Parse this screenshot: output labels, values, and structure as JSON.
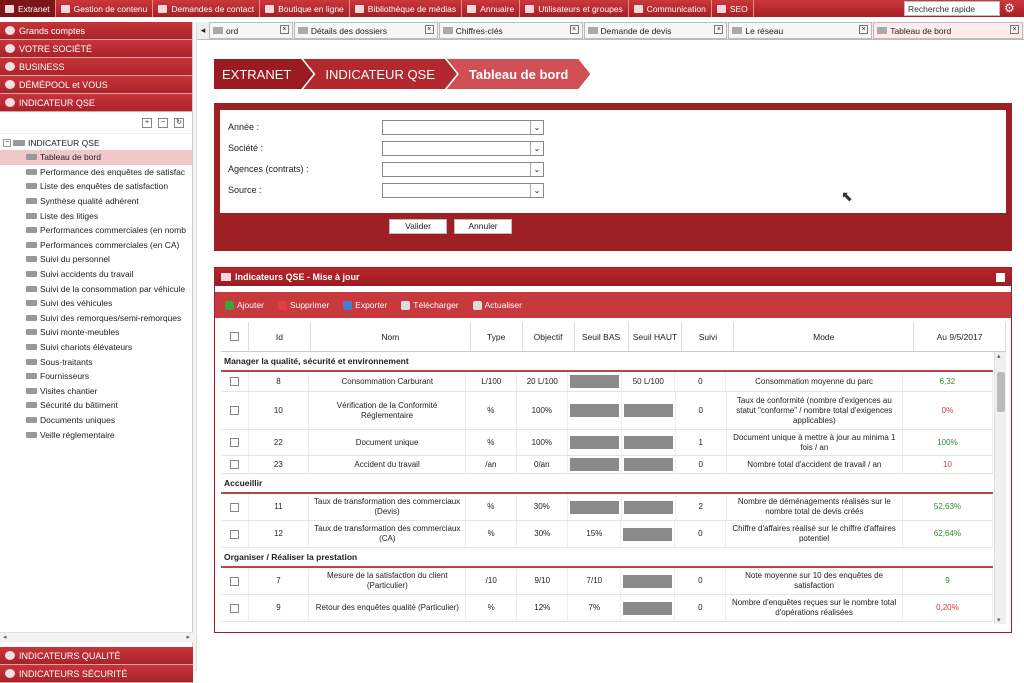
{
  "topbar": {
    "items": [
      {
        "label": "Extranet",
        "icon": "home-icon",
        "active": true
      },
      {
        "label": "Gestion de contenu",
        "icon": "document-icon"
      },
      {
        "label": "Demandes de contact",
        "icon": "folder-icon"
      },
      {
        "label": "Boutique en ligne",
        "icon": "cart-icon"
      },
      {
        "label": "Bibliothèque de médias",
        "icon": "media-icon"
      },
      {
        "label": "Annuaire",
        "icon": "home-icon"
      },
      {
        "label": "Utilisateurs et groupes",
        "icon": "users-icon"
      },
      {
        "label": "Communication",
        "icon": "mail-icon"
      },
      {
        "label": "SEO",
        "icon": "globe-icon"
      }
    ],
    "search_value": "Recherche rapide"
  },
  "sidebar": {
    "sections": [
      {
        "label": "Grands comptes",
        "icon": "globe-icon"
      },
      {
        "label": "VOTRE SOCIÉTÉ",
        "icon": "house-icon"
      },
      {
        "label": "BUSINESS",
        "icon": "cart-icon"
      },
      {
        "label": "DÉMÉPOOL et VOUS",
        "icon": "users-icon"
      },
      {
        "label": "INDICATEUR QSE",
        "icon": "gauge-icon"
      }
    ],
    "tree_root": "INDICATEUR QSE",
    "tree_items": [
      "Tableau de bord",
      "Performance des enquêtes de satisfac",
      "Liste des enquêtes de satisfaction",
      "Synthèse qualité adhérent",
      "Liste des litiges",
      "Performances commerciales (en nomb",
      "Performances commerciales (en CA)",
      "Suivi du personnel",
      "Suivi accidents du travail",
      "Suivi de la consommation par véhicule",
      "Suivi des véhicules",
      "Suivi des remorques/semi-remorques",
      "Suivi monte-meubles",
      "Suivi chariots élévateurs",
      "Sous-traitants",
      "Fournisseurs",
      "Visites chantier",
      "Sécurité du bâtiment",
      "Documents uniques",
      "Veille réglementaire"
    ],
    "bottom_sections": [
      "INDICATEURS QUALITÉ",
      "INDICATEURS SÉCURITÉ"
    ]
  },
  "tabs": [
    {
      "label": "ord"
    },
    {
      "label": "Détails des dossiers"
    },
    {
      "label": "Chiffres-clés"
    },
    {
      "label": "Demande de devis"
    },
    {
      "label": "Le réseau"
    },
    {
      "label": "Tableau de bord",
      "active": true
    }
  ],
  "breadcrumb": [
    "EXTRANET",
    "INDICATEUR QSE",
    "Tableau de bord"
  ],
  "filter": {
    "fields": [
      {
        "label": "Année :",
        "value": ""
      },
      {
        "label": "Société :",
        "value": ""
      },
      {
        "label": "Agences (contrats) :",
        "value": ""
      },
      {
        "label": "Source :",
        "value": ""
      }
    ],
    "validate_label": "Valider",
    "cancel_label": "Annuler"
  },
  "panel": {
    "title": "Indicateurs QSE - Mise à jour",
    "toolbar": [
      {
        "label": "Ajouter",
        "icon": "add-icon",
        "color": "#3aa53a"
      },
      {
        "label": "Supprimer",
        "icon": "delete-icon",
        "color": "#e04040"
      },
      {
        "label": "Exporter",
        "icon": "export-icon",
        "color": "#4a7bd0"
      },
      {
        "label": "Télécharger",
        "icon": "download-icon",
        "color": "#dddddd"
      },
      {
        "label": "Actualiser",
        "icon": "refresh-icon",
        "color": "#dddddd"
      }
    ],
    "columns": [
      "Id",
      "Nom",
      "Type",
      "Objectif",
      "Seuil BAS",
      "Seuil HAUT",
      "Suivi",
      "Mode",
      "Au 9/5/2017"
    ],
    "groups": [
      {
        "title": "Manager la qualité, sécurité et environnement",
        "rows": [
          {
            "id": "8",
            "nom": "Consommation Carburant",
            "type": "L/100",
            "objectif": "20 L/100",
            "bas": "",
            "haut": "50 L/100",
            "suivi": "0",
            "mode": "Consommation moyenne du parc",
            "val": "6,32",
            "status": "good",
            "h": 20
          },
          {
            "id": "10",
            "nom": "Vérification de la Conformité Réglementaire",
            "type": "%",
            "objectif": "100%",
            "bas": "",
            "haut": "",
            "suivi": "0",
            "mode": "Taux de conformité (nombre d'exigences au statut \"conforme\" / nombre total d'exigences applicables)",
            "val": "0%",
            "status": "bad",
            "h": 38
          },
          {
            "id": "22",
            "nom": "Document unique",
            "type": "%",
            "objectif": "100%",
            "bas": "",
            "haut": "",
            "suivi": "1",
            "mode": "Document unique à mettre à jour au minima 1 fois / an",
            "val": "100%",
            "status": "good",
            "h": 26
          },
          {
            "id": "23",
            "nom": "Accident du travail",
            "type": "/an",
            "objectif": "0/an",
            "bas": "",
            "haut": "",
            "suivi": "0",
            "mode": "Nombre total d'accident de travail / an",
            "val": "10",
            "status": "bad",
            "h": 18
          }
        ]
      },
      {
        "title": "Accueillir",
        "rows": [
          {
            "id": "11",
            "nom": "Taux de transformation des commerciaux (Devis)",
            "type": "%",
            "objectif": "30%",
            "bas": "",
            "haut": "",
            "suivi": "2",
            "mode": "Nombre de déménagements réalisés sur le nombre total de devis créés",
            "val": "52,63%",
            "status": "good",
            "h": 27
          },
          {
            "id": "12",
            "nom": "Taux de transformation des commerciaux (CA)",
            "type": "%",
            "objectif": "30%",
            "bas": "15%",
            "haut": "",
            "suivi": "0",
            "mode": "Chiffre d'affaires réalisé sur le chiffre d'affaires potentiel",
            "val": "62,64%",
            "status": "good",
            "h": 27
          }
        ]
      },
      {
        "title": "Organiser / Réaliser la prestation",
        "rows": [
          {
            "id": "7",
            "nom": "Mesure de la satisfaction du client (Particulier)",
            "type": "/10",
            "objectif": "9/10",
            "bas": "7/10",
            "haut": "",
            "suivi": "0",
            "mode": "Note moyenne sur 10 des enquêtes de satisfaction",
            "val": "9",
            "status": "good",
            "h": 27
          },
          {
            "id": "9",
            "nom": "Retour des enquêtes qualité (Particulier)",
            "type": "%",
            "objectif": "12%",
            "bas": "7%",
            "haut": "",
            "suivi": "0",
            "mode": "Nombre d'enquêtes reçues sur le nombre total d'opérations réalisées",
            "val": "0,20%",
            "status": "bad",
            "h": 27
          }
        ]
      }
    ]
  },
  "colors": {
    "accent": "#a61f25",
    "good": "#2e8b2e",
    "bad": "#d23a3a"
  }
}
